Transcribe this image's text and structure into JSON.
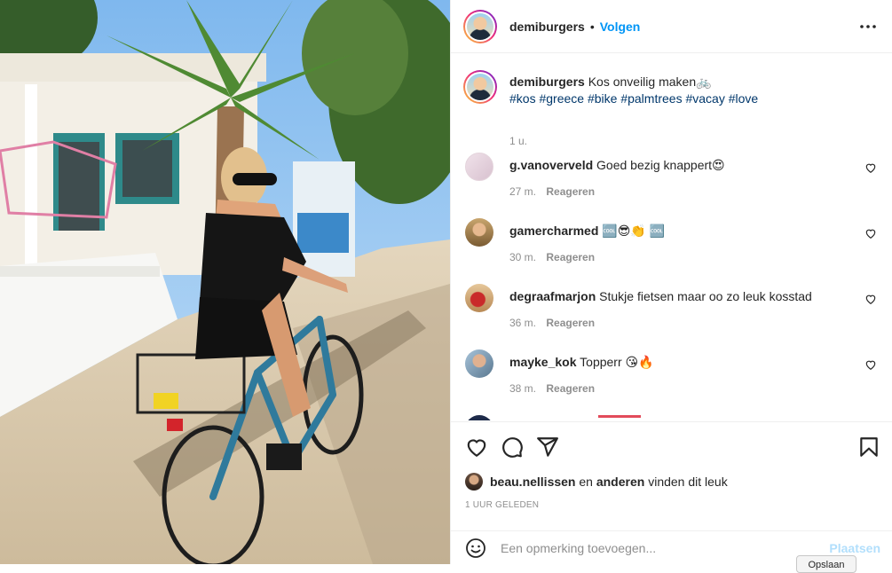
{
  "header": {
    "username": "demiburgers",
    "separator": "•",
    "follow_label": "Volgen"
  },
  "caption": {
    "username": "demiburgers",
    "text": "Kos onveilig maken🚲",
    "hashtags": [
      "#kos",
      "#greece",
      "#bike",
      "#palmtrees",
      "#vacay",
      "#love"
    ],
    "time": "1 u."
  },
  "comments": [
    {
      "username": "g.vanoverveld",
      "text": "Goed bezig knappert😍",
      "time": "27 m.",
      "reply_label": "Reageren"
    },
    {
      "username": "gamercharmed",
      "text": "🆒😎👏 🆒",
      "time": "30 m.",
      "reply_label": "Reageren"
    },
    {
      "username": "degraafmarjon",
      "text": "Stukje fietsen maar oo zo leuk kosstad",
      "time": "36 m.",
      "reply_label": "Reageren"
    },
    {
      "username": "mayke_kok",
      "text": "Topperr 😘🔥",
      "time": "38 m.",
      "reply_label": "Reageren"
    }
  ],
  "likes": {
    "user": "beau.nellissen",
    "connector": "en",
    "others": "anderen",
    "suffix": "vinden dit leuk"
  },
  "posted_time": "1 uur geleden",
  "comment_box": {
    "placeholder": "Een opmerking toevoegen...",
    "post_label": "Plaatsen"
  },
  "tooltip": "Opslaan",
  "icons": {
    "more": "more-options-icon",
    "like": "heart-icon",
    "comment": "comment-icon",
    "share": "share-icon",
    "save": "bookmark-icon",
    "emoji": "emoji-icon"
  },
  "colors": {
    "accent": "#0095f6",
    "hashtag": "#00376b",
    "muted": "#8e8e8e",
    "post_disabled": "#b2dffc"
  }
}
